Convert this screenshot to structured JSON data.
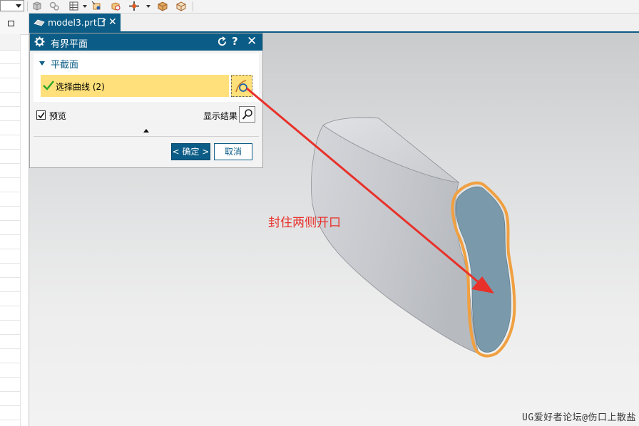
{
  "tab": {
    "title": "model3.prt"
  },
  "dialog": {
    "title": "有界平面",
    "section_label": "平截面",
    "select_curve_label": "选择曲线 (2)",
    "preview_label": "预览",
    "show_result_label": "显示结果",
    "ok_label": "< 确定 >",
    "cancel_label": "取消",
    "help_glyph": "?",
    "close_glyph": "✕",
    "preview_checked": true
  },
  "annotation": {
    "text": "封住两侧开口",
    "color": "#e8312a"
  },
  "watermark": "UG爱好者论坛@伤口上散盐",
  "colors": {
    "title_bar": "#0b5c86",
    "selection_highlight": "#ffe07a",
    "edge_highlight": "#f0a040",
    "cap_face": "#7a9aac",
    "body_face": "#c9cbd0"
  },
  "icons": {
    "toolbar": [
      "part-icon",
      "gear-link-icon",
      "table-icon",
      "view-icon",
      "box-add-icon",
      "snap-point-icon",
      "shaded-box-icon",
      "wire-box-icon"
    ],
    "dialog": [
      "gear-icon",
      "reset-icon",
      "help-icon",
      "close-icon",
      "check-icon",
      "curve-select-icon",
      "magnifier-icon"
    ]
  }
}
